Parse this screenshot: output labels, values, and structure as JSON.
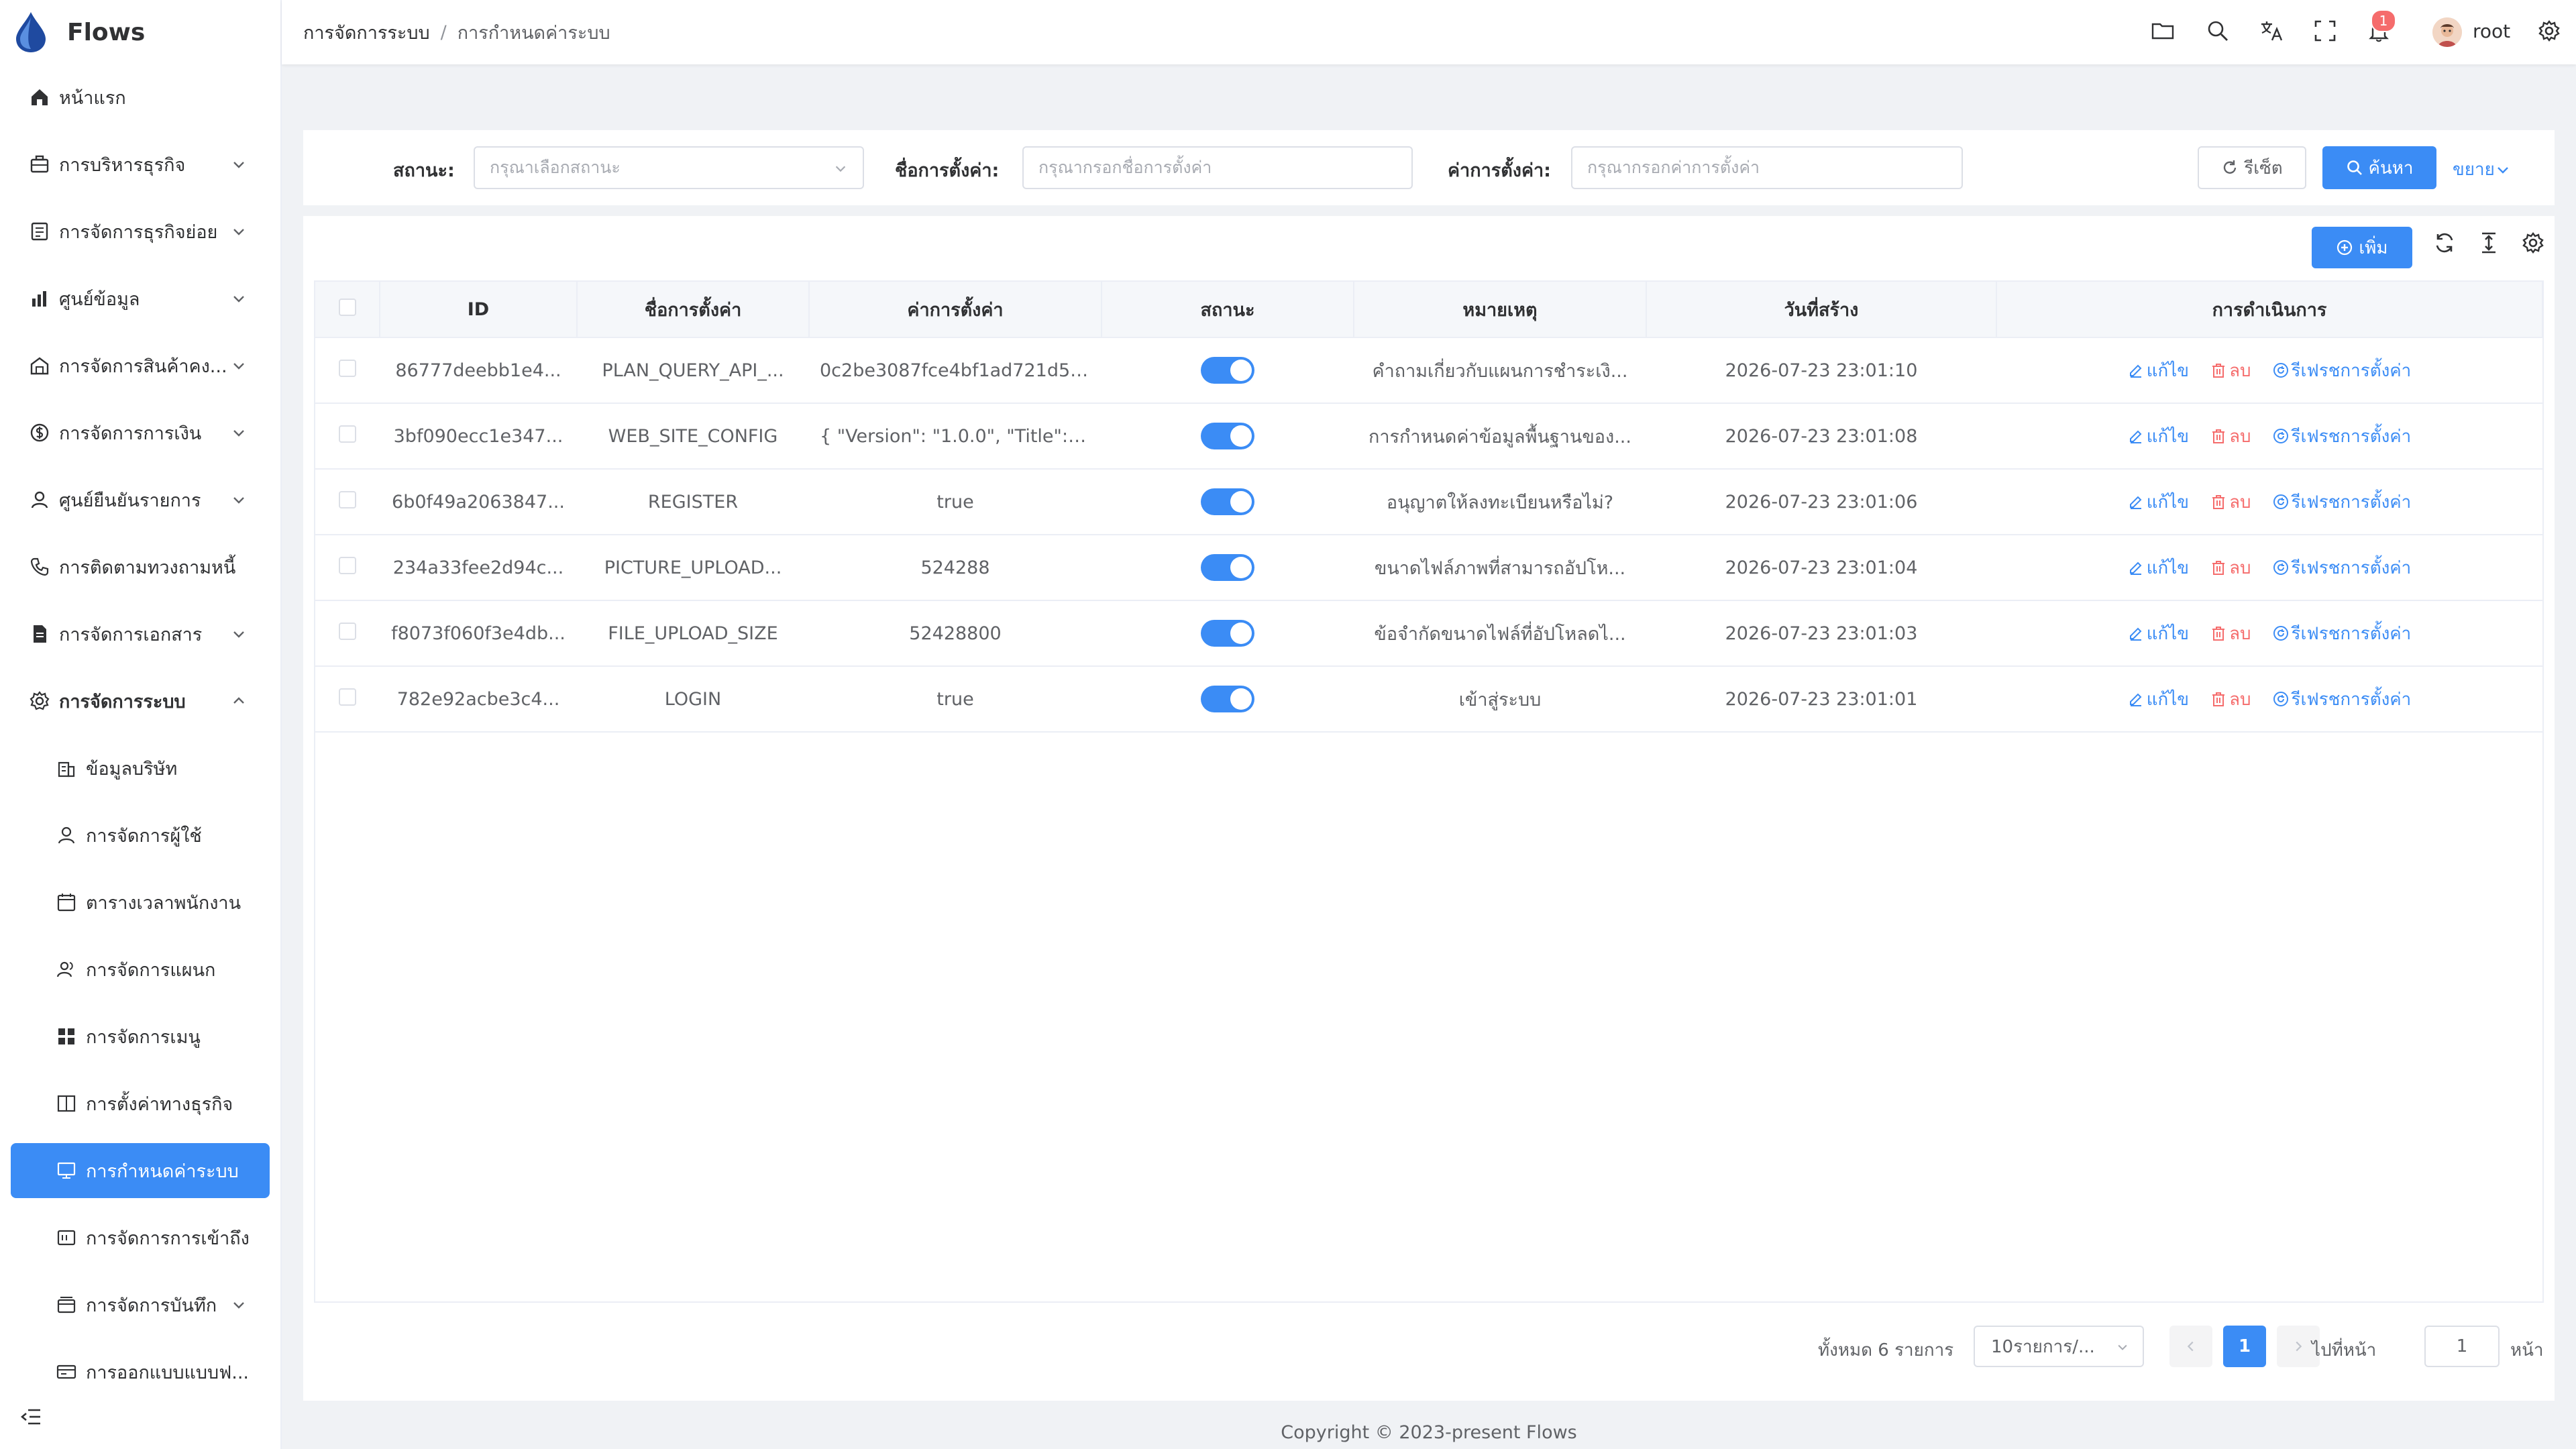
{
  "app": {
    "name": "Flows"
  },
  "sidebar": {
    "items": [
      {
        "label": "หน้าแรก",
        "icon": "home-icon"
      },
      {
        "label": "การบริหารธุรกิจ",
        "icon": "briefcase-icon"
      },
      {
        "label": "การจัดการธุรกิจย่อย",
        "icon": "document-icon"
      },
      {
        "label": "ศูนย์ข้อมูล",
        "icon": "bar-chart-icon"
      },
      {
        "label": "การจัดการสินค้าคง...",
        "icon": "warehouse-icon"
      },
      {
        "label": "การจัดการการเงิน",
        "icon": "money-icon"
      },
      {
        "label": "ศูนย์ยืนยันรายการ",
        "icon": "user-check-icon"
      },
      {
        "label": "การติดตามทวงถามหนี้",
        "icon": "phone-icon"
      },
      {
        "label": "การจัดการเอกสาร",
        "icon": "file-icon"
      },
      {
        "label": "การจัดการระบบ",
        "icon": "gear-icon"
      }
    ],
    "subitems": [
      {
        "label": "ข้อมูลบริษัท",
        "icon": "building-icon"
      },
      {
        "label": "การจัดการผู้ใช้",
        "icon": "user-icon"
      },
      {
        "label": "ตารางเวลาพนักงาน",
        "icon": "calendar-icon"
      },
      {
        "label": "การจัดการแผนก",
        "icon": "users-icon"
      },
      {
        "label": "การจัดการเมนู",
        "icon": "grid-icon"
      },
      {
        "label": "การตั้งค่าทางธุรกิจ",
        "icon": "book-icon"
      },
      {
        "label": "การกำหนดค่าระบบ",
        "icon": "monitor-icon"
      },
      {
        "label": "การจัดการการเข้าถึง",
        "icon": "key-icon"
      },
      {
        "label": "การจัดการบันทึก",
        "icon": "log-icon"
      },
      {
        "label": "การออกแบบแบบฟ...",
        "icon": "form-icon"
      }
    ]
  },
  "header": {
    "breadcrumb": [
      "การจัดการระบบ",
      "การกำหนดค่าระบบ"
    ],
    "notification_count": "1",
    "username": "root"
  },
  "search": {
    "status_label": "สถานะ:",
    "status_placeholder": "กรุณาเลือกสถานะ",
    "name_label": "ชื่อการตั้งค่า:",
    "name_placeholder": "กรุณากรอกชื่อการตั้งค่า",
    "value_label": "ค่าการตั้งค่า:",
    "value_placeholder": "กรุณากรอกค่าการตั้งค่า",
    "reset_label": "รีเซ็ต",
    "search_label": "ค้นหา",
    "expand_label": "ขยาย"
  },
  "toolbar": {
    "add_label": "เพิ่ม"
  },
  "table": {
    "columns": [
      "ID",
      "ชื่อการตั้งค่า",
      "ค่าการตั้งค่า",
      "สถานะ",
      "หมายเหตุ",
      "วันที่สร้าง",
      "การดำเนินการ"
    ],
    "actions": {
      "edit": "แก้ไข",
      "delete": "ลบ",
      "refresh": "รีเฟรชการตั้งค่า"
    },
    "rows": [
      {
        "id": "86777deebb1e4...",
        "name": "PLAN_QUERY_API_...",
        "value": "0c2be3087fce4bf1ad721d55...",
        "enabled": true,
        "remark": "คำถามเกี่ยวกับแผนการชำระเงิ...",
        "created": "2026-07-23 23:01:10"
      },
      {
        "id": "3bf090ecc1e347...",
        "name": "WEB_SITE_CONFIG",
        "value": "{ \"Version\": \"1.0.0\", \"Title\": \"...",
        "enabled": true,
        "remark": "การกำหนดค่าข้อมูลพื้นฐานของ...",
        "created": "2026-07-23 23:01:08"
      },
      {
        "id": "6b0f49a2063847...",
        "name": "REGISTER",
        "value": "true",
        "enabled": true,
        "remark": "อนุญาตให้ลงทะเบียนหรือไม่?",
        "created": "2026-07-23 23:01:06"
      },
      {
        "id": "234a33fee2d94c...",
        "name": "PICTURE_UPLOAD...",
        "value": "524288",
        "enabled": true,
        "remark": "ขนาดไฟล์ภาพที่สามารถอัปโห...",
        "created": "2026-07-23 23:01:04"
      },
      {
        "id": "f8073f060f3e4db...",
        "name": "FILE_UPLOAD_SIZE",
        "value": "52428800",
        "enabled": true,
        "remark": "ข้อจำกัดขนาดไฟล์ที่อัปโหลดไ...",
        "created": "2026-07-23 23:01:03"
      },
      {
        "id": "782e92acbe3c4...",
        "name": "LOGIN",
        "value": "true",
        "enabled": true,
        "remark": "เข้าสู่ระบบ",
        "created": "2026-07-23 23:01:01"
      }
    ]
  },
  "pagination": {
    "total_text": "ทั้งหมด 6 รายการ",
    "page_size": "10รายการ/...",
    "current_page": "1",
    "goto_label": "ไปที่หน้า",
    "goto_value": "1",
    "goto_unit": "หน้า"
  },
  "footer": {
    "copyright": "Copyright © 2023-present Flows"
  },
  "colors": {
    "primary": "#3b8cf5",
    "danger": "#f56c6c",
    "background": "#f0f2f5"
  }
}
